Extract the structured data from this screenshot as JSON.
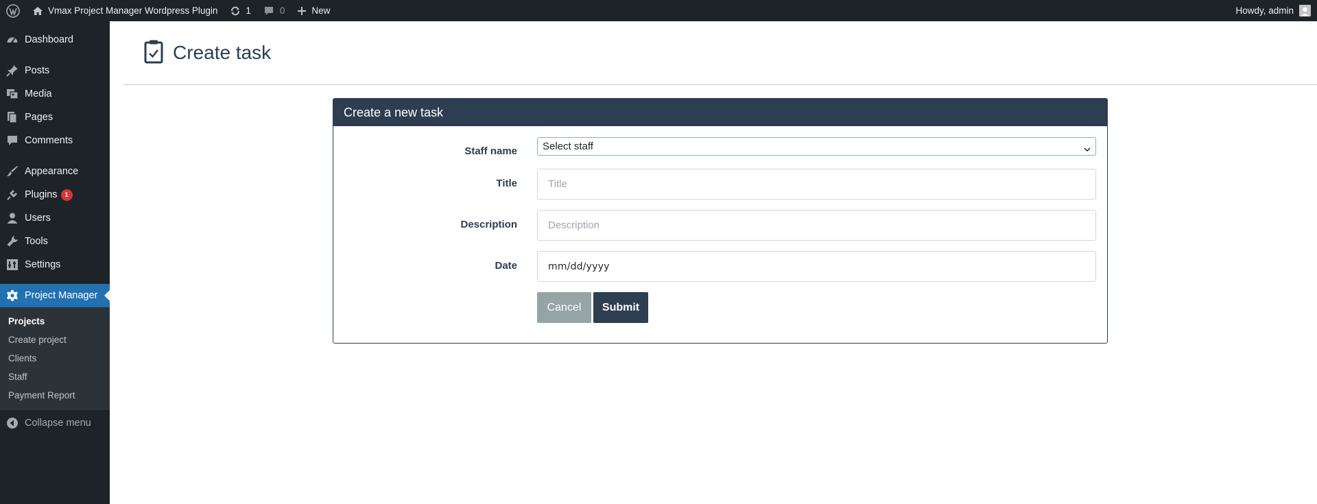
{
  "adminbar": {
    "site_name": "Vmax Project Manager Wordpress Plugin",
    "updates_count": "1",
    "comments_count": "0",
    "new_label": "New",
    "howdy": "Howdy, admin"
  },
  "sidebar": {
    "items": [
      {
        "label": "Dashboard",
        "icon": "dashboard-icon"
      },
      {
        "label": "Posts",
        "icon": "pin-icon"
      },
      {
        "label": "Media",
        "icon": "media-icon"
      },
      {
        "label": "Pages",
        "icon": "pages-icon"
      },
      {
        "label": "Comments",
        "icon": "comments-icon"
      },
      {
        "label": "Appearance",
        "icon": "brush-icon"
      },
      {
        "label": "Plugins",
        "icon": "plugin-icon",
        "badge": "1"
      },
      {
        "label": "Users",
        "icon": "user-icon"
      },
      {
        "label": "Tools",
        "icon": "wrench-icon"
      },
      {
        "label": "Settings",
        "icon": "settings-icon"
      },
      {
        "label": "Project Manager",
        "icon": "gear-icon"
      }
    ],
    "submenu": [
      "Projects",
      "Create project",
      "Clients",
      "Staff",
      "Payment Report"
    ],
    "collapse_label": "Collapse menu"
  },
  "page": {
    "title": "Create task"
  },
  "form": {
    "header": "Create a new task",
    "staff_label": "Staff name",
    "staff_selected": "Select staff",
    "title_label": "Title",
    "title_placeholder": "Title",
    "description_label": "Description",
    "description_placeholder": "Description",
    "date_label": "Date",
    "date_placeholder": "mm/dd/yyyy",
    "cancel_label": "Cancel",
    "submit_label": "Submit"
  },
  "colors": {
    "accent": "#2271b1",
    "header": "#2d3e50",
    "cancel": "#95a5a6",
    "badge": "#d63638"
  }
}
